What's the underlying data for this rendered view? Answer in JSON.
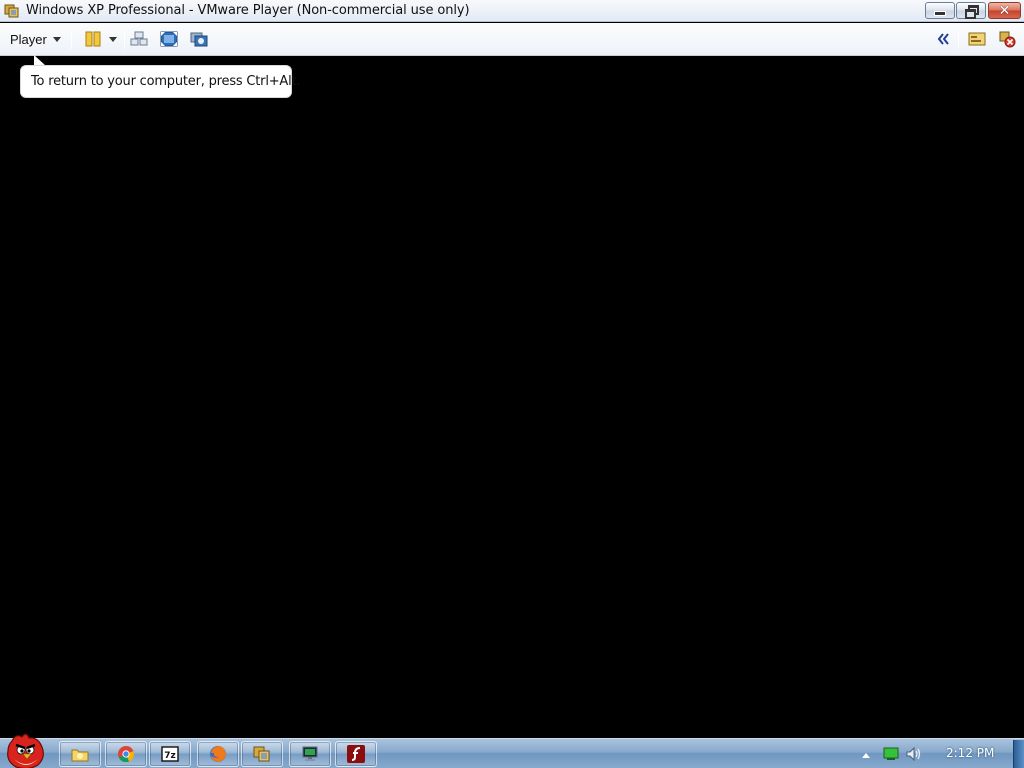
{
  "window": {
    "title": "Windows XP Professional - VMware Player (Non-commercial use only)",
    "icon": "vmware-player-icon",
    "controls": {
      "minimize": "minimize-icon",
      "restore": "restore-icon",
      "close": "close-icon"
    }
  },
  "toolbar": {
    "player_menu_label": "Player",
    "buttons": [
      {
        "name": "pause-vm-button",
        "icon": "pause-icon"
      },
      {
        "name": "pause-dropdown-button",
        "icon": "chevron-down-icon"
      },
      {
        "name": "send-ctrl-alt-del-button",
        "icon": "ctrl-alt-del-icon"
      },
      {
        "name": "full-screen-button",
        "icon": "full-screen-icon"
      },
      {
        "name": "unity-button",
        "icon": "unity-icon"
      },
      {
        "name": "collapse-toolbar-button",
        "icon": "double-chevron-left-icon"
      },
      {
        "name": "removable-devices-button",
        "icon": "devices-icon"
      },
      {
        "name": "disconnect-button",
        "icon": "disconnect-icon"
      }
    ]
  },
  "tooltip": {
    "text": "To return to your computer, press Ctrl+Alt."
  },
  "taskbar": {
    "start_button_icon": "angry-bird-start-icon",
    "pinned_items": [
      {
        "name": "taskbar-explorer",
        "icon": "folder-icon"
      },
      {
        "name": "taskbar-chrome",
        "icon": "chrome-icon"
      },
      {
        "name": "taskbar-7zip",
        "icon": "7zip-icon"
      },
      {
        "name": "taskbar-firefox",
        "icon": "firefox-icon"
      },
      {
        "name": "taskbar-vmware",
        "icon": "vmware-icon"
      },
      {
        "name": "taskbar-network",
        "icon": "network-computer-icon"
      },
      {
        "name": "taskbar-flash",
        "icon": "flash-icon"
      }
    ],
    "tray": {
      "icons": [
        "show-hidden-icons-icon",
        "battery-icon",
        "volume-icon"
      ],
      "clock": "2:12 PM"
    }
  },
  "colors": {
    "vm_background": "#000000",
    "taskbar": "#7fa3c8",
    "flash": "#8b0d0d"
  }
}
